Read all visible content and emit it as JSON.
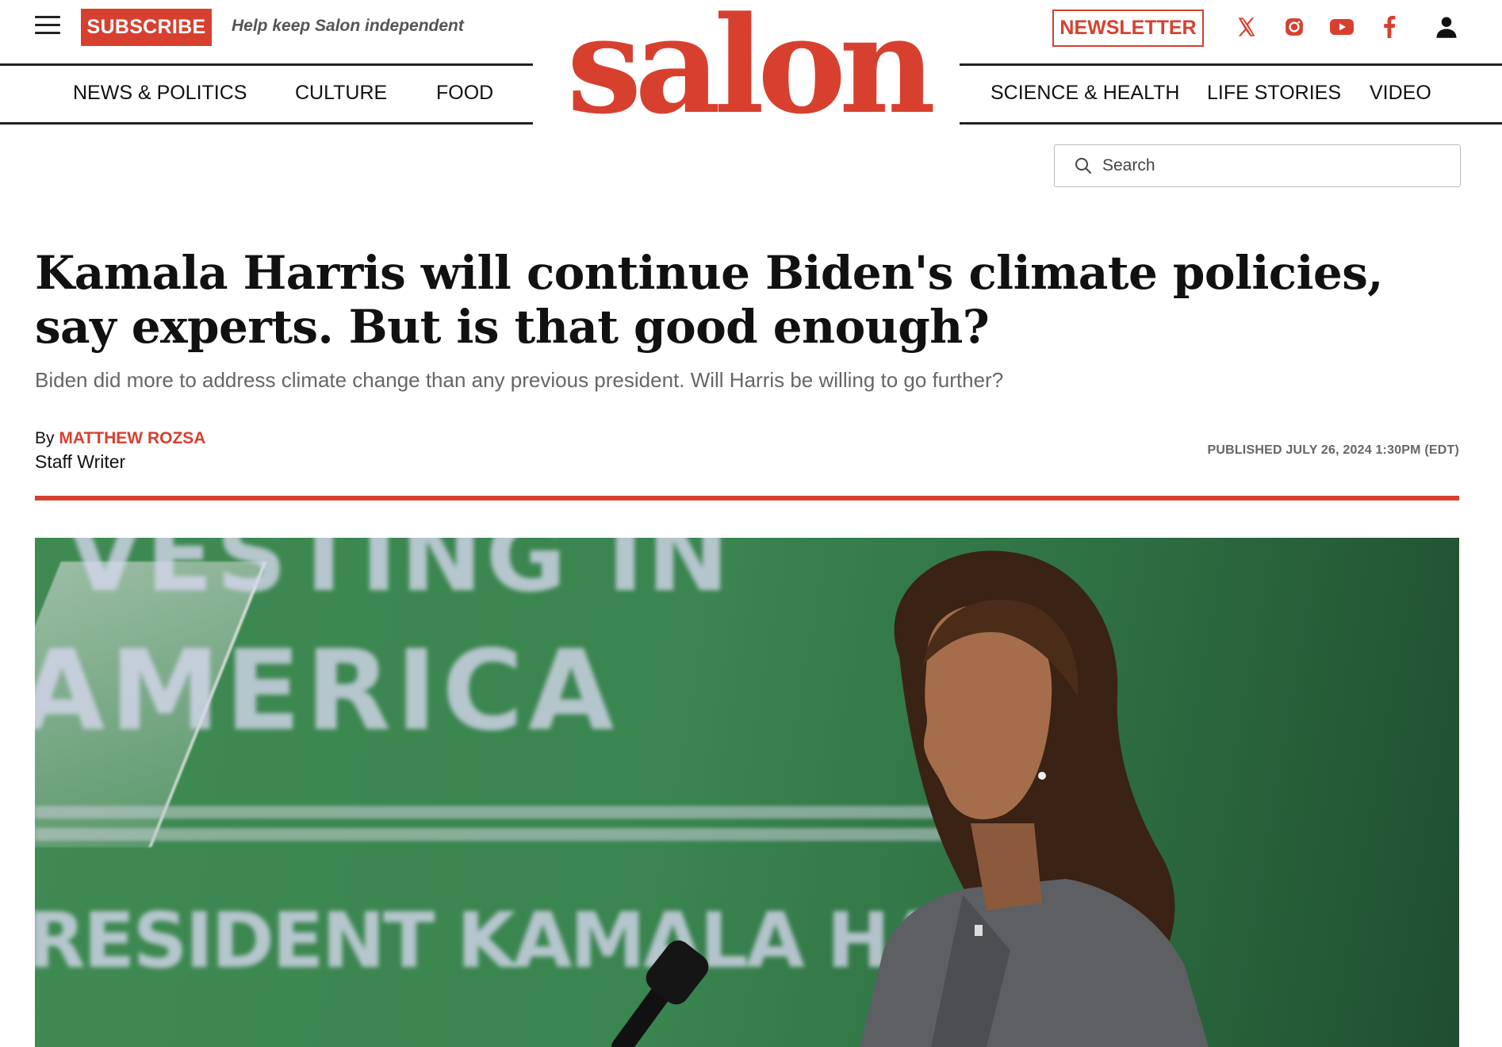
{
  "header": {
    "subscribe_label": "SUBSCRIBE",
    "tagline": "Help keep Salon independent",
    "newsletter_label": "NEWSLETTER",
    "logo_text": "salon",
    "social_icons": [
      "x-icon",
      "instagram-icon",
      "youtube-icon",
      "facebook-icon",
      "user-icon"
    ]
  },
  "nav": {
    "left": [
      "NEWS & POLITICS",
      "CULTURE",
      "FOOD"
    ],
    "right": [
      "SCIENCE & HEALTH",
      "LIFE STORIES",
      "VIDEO"
    ]
  },
  "search": {
    "placeholder": "Search"
  },
  "article": {
    "headline": "Kamala Harris will continue Biden's climate policies, say experts. But is that good enough?",
    "dek": "Biden did more to address climate change than any previous president. Will Harris be willing to go further?",
    "by_prefix": "By",
    "author": "MATTHEW ROZSA",
    "author_role": "Staff Writer",
    "published": "PUBLISHED JULY 26, 2024 1:30PM (EDT)"
  },
  "hero_image": {
    "visible_text_line1": "VESTING IN",
    "visible_text_line2": "AMERICA",
    "visible_text_line3": "RESIDENT KAMALA HAR"
  },
  "colors": {
    "brand_red": "#d7402f",
    "text": "#111111",
    "muted": "#666666"
  }
}
